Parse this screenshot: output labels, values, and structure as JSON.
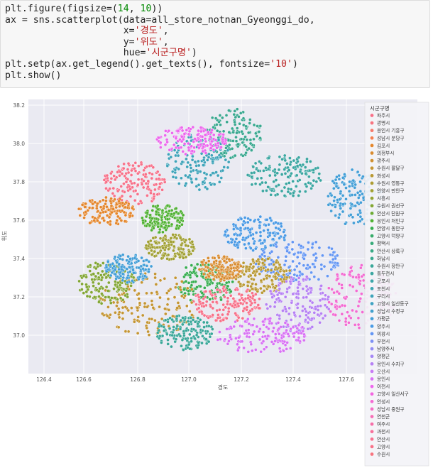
{
  "code": {
    "lines": [
      [
        "plt.figure(figsize=(",
        {
          "t": "14",
          "c": "num"
        },
        ", ",
        {
          "t": "10",
          "c": "num"
        },
        "))"
      ],
      [
        "ax = sns.scatterplot(data=all_store_notnan_Gyeonggi_do,"
      ],
      [
        "                     x=",
        {
          "t": "'경도'",
          "c": "str"
        },
        ","
      ],
      [
        "                     y=",
        {
          "t": "'위도'",
          "c": "str"
        },
        ","
      ],
      [
        "                     hue=",
        {
          "t": "'시군구명'",
          "c": "str"
        },
        ")"
      ],
      [
        "plt.setp(ax.get_legend().get_texts(), fontsize=",
        {
          "t": "'10'",
          "c": "str"
        },
        ")"
      ],
      [
        "plt.show()"
      ]
    ]
  },
  "chart_data": {
    "type": "scatter",
    "xlabel": "경도",
    "ylabel": "위도",
    "xlim": [
      126.4,
      127.7
    ],
    "ylim": [
      36.85,
      37.25
    ],
    "xticks": [
      "126.4",
      "126.6",
      "126.8",
      "127.0",
      "127.2",
      "127.4",
      "127.6"
    ],
    "yticks": [
      "37.0",
      "37.2",
      "37.4",
      "37.6",
      "37.8",
      "38.0",
      "38.2"
    ],
    "ytick_values": [
      37.0,
      37.2,
      37.4,
      37.6,
      37.8,
      38.0,
      38.2
    ],
    "grid": true,
    "legend": {
      "title": "시군구명",
      "placement": "right",
      "entries": [
        {
          "name": "파주시",
          "color": "#f77189"
        },
        {
          "name": "광명시",
          "color": "#f67580"
        },
        {
          "name": "용인시 기흥구",
          "color": "#f57b6c"
        },
        {
          "name": "성남시 분당구",
          "color": "#f47f50"
        },
        {
          "name": "김포시",
          "color": "#e4862c"
        },
        {
          "name": "의정부시",
          "color": "#d98c31"
        },
        {
          "name": "광주시",
          "color": "#cf9032"
        },
        {
          "name": "수원시 팔달구",
          "color": "#c49533"
        },
        {
          "name": "화성시",
          "color": "#b99934"
        },
        {
          "name": "수원시 영통구",
          "color": "#ad9c34"
        },
        {
          "name": "안양시 만안구",
          "color": "#a1a034"
        },
        {
          "name": "시흥시",
          "color": "#93a334"
        },
        {
          "name": "수원시 권선구",
          "color": "#82a634"
        },
        {
          "name": "안산시 단원구",
          "color": "#6daa34"
        },
        {
          "name": "용인시 처인구",
          "color": "#50b133"
        },
        {
          "name": "안양시 동안구",
          "color": "#36ad50"
        },
        {
          "name": "고양시 덕양구",
          "color": "#37ab6a"
        },
        {
          "name": "평택시",
          "color": "#38aa7a"
        },
        {
          "name": "안산시 상록구",
          "color": "#39a986"
        },
        {
          "name": "하남시",
          "color": "#3aa890"
        },
        {
          "name": "수원시 장안구",
          "color": "#3aa799"
        },
        {
          "name": "동두천시",
          "color": "#3ba6a1"
        },
        {
          "name": "군포시",
          "color": "#3ca5a9"
        },
        {
          "name": "포천시",
          "color": "#3da4b1"
        },
        {
          "name": "구리시",
          "color": "#3ea3b9"
        },
        {
          "name": "고양시 일산동구",
          "color": "#40a2c2"
        },
        {
          "name": "성남시 수정구",
          "color": "#41a0cc"
        },
        {
          "name": "가평군",
          "color": "#439ed7"
        },
        {
          "name": "양주시",
          "color": "#4a9ae5"
        },
        {
          "name": "의왕시",
          "color": "#6496f4"
        },
        {
          "name": "부천시",
          "color": "#7e91f4"
        },
        {
          "name": "남양주시",
          "color": "#928cf4"
        },
        {
          "name": "양평군",
          "color": "#a487f4"
        },
        {
          "name": "용인시 수지구",
          "color": "#b681f4"
        },
        {
          "name": "오산시",
          "color": "#c77bf4"
        },
        {
          "name": "용인시",
          "color": "#d872f4"
        },
        {
          "name": "이천시",
          "color": "#ec67ed"
        },
        {
          "name": "고양시 일산서구",
          "color": "#f267e0"
        },
        {
          "name": "안성시",
          "color": "#f36ad2"
        },
        {
          "name": "성남시 중원구",
          "color": "#f46dc5"
        },
        {
          "name": "연천군",
          "color": "#f56eb7"
        },
        {
          "name": "여주시",
          "color": "#f56fa9"
        },
        {
          "name": "과천시",
          "color": "#f6709b"
        },
        {
          "name": "안산시",
          "color": "#f77290"
        },
        {
          "name": "고양시",
          "color": "#f77189"
        },
        {
          "name": "수원시",
          "color": "#f67580"
        }
      ]
    }
  }
}
